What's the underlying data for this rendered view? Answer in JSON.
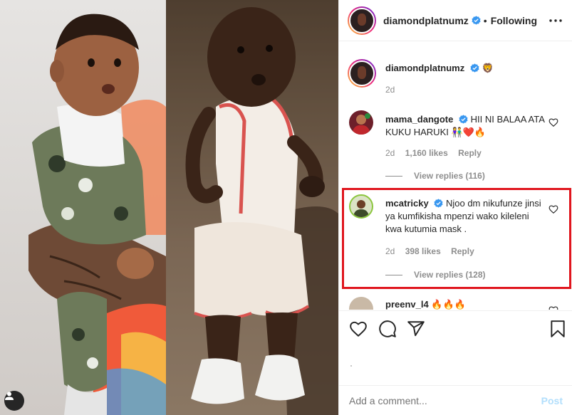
{
  "post": {
    "username": "diamondplatnumz",
    "follow_status": "Following",
    "separator": "•",
    "caption_emoji": "🦁",
    "caption_time": "2d",
    "colors": {
      "verified": "#3897f0",
      "highlight": "#e0161e",
      "ring": "#ee2a7b"
    }
  },
  "comments": [
    {
      "username": "mama_dangote",
      "text": "HII NI BALAA ATA KUKU HARUKI 👫❤️🔥",
      "time": "2d",
      "likes": "1,160 likes",
      "reply_label": "Reply",
      "view_replies": "View replies (116)"
    },
    {
      "username": "mcatricky",
      "text": "Njoo dm nikufunze jinsi ya kumfikisha mpenzi wako kileleni kwa kutumia mask .",
      "time": "2d",
      "likes": "398 likes",
      "reply_label": "Reply",
      "view_replies": "View replies (128)"
    },
    {
      "username": "preenv_l4",
      "text": "🔥🔥🔥"
    }
  ],
  "add_comment": {
    "placeholder": "Add a comment...",
    "post_label": "Post"
  },
  "icons": [
    "more-icon",
    "heart-icon",
    "comment-icon",
    "share-icon",
    "save-icon",
    "user-tag-icon",
    "verified-icon"
  ]
}
